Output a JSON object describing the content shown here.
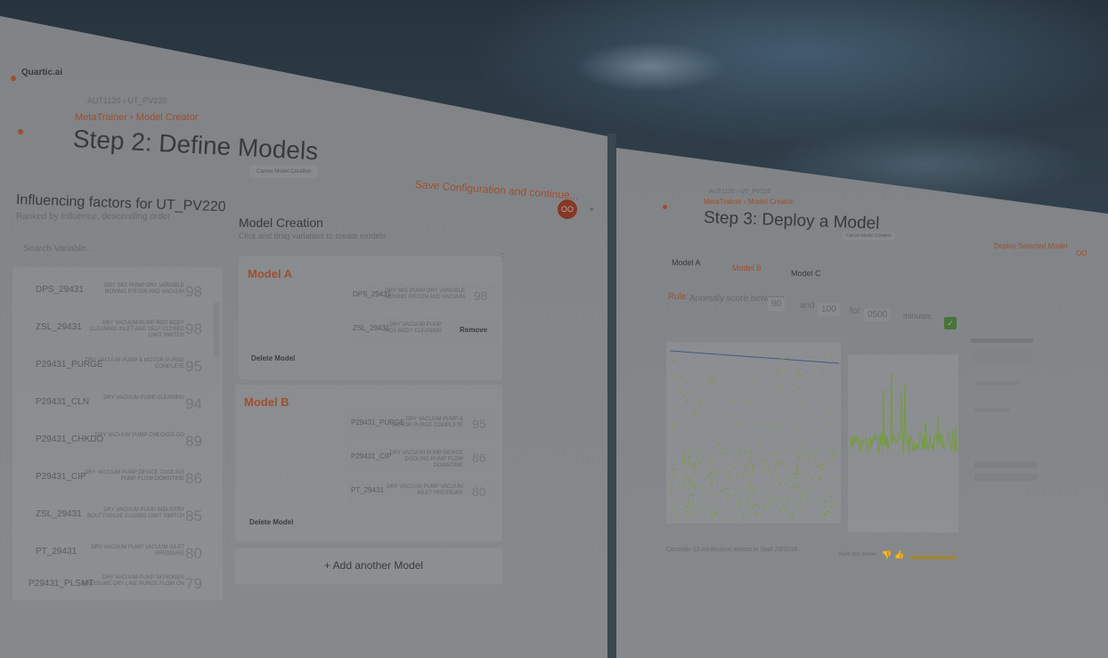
{
  "left": {
    "logo": "Quartic.ai",
    "breadcrumb": "AUT1120 › UT_PV220",
    "section": "MetaTrainer › Model Creator",
    "title": "Step 2: Define Models",
    "cancel_label": "Cancel Model Creation",
    "save_label": "Save Configuration and continue...",
    "avatar": "OO",
    "factors": {
      "title": "Influencing factors for UT_PV220",
      "subtitle": "Ranked by influence, descending order",
      "search_placeholder": "Search Variable...",
      "rows": [
        {
          "name": "DPS_29431",
          "desc": "DRY SKE PUMP DRY VARIABLE MOVING PISTON AND VACUUM",
          "score": "98"
        },
        {
          "name": "ZSL_29431",
          "desc": "DRY VACUUM PUMP ROS BODY CLEANING INLET AND SELF CLOSED LIMIT SWITCH",
          "score": "98"
        },
        {
          "name": "P29431_PURGE",
          "desc": "DRY VACUUM PUMP & MOTOR PURGE COMPLETE",
          "score": "95"
        },
        {
          "name": "P29431_CLN",
          "desc": "DRY VACUUM PUMP CLEANING",
          "score": "94"
        },
        {
          "name": "P29431_CHKDO",
          "desc": "DRY VACUUM PUMP CHECKED DO",
          "score": "89"
        },
        {
          "name": "P29431_CIP",
          "desc": "DRY VACUUM PUMP DEVICE COOLING PUMP FLOW DOWNTIME",
          "score": "86"
        },
        {
          "name": "ZSL_29431",
          "desc": "DRY VACUUM PUMP INDUSTRY BOUTTIVALVE CLOSED LIMIT SWITCH",
          "score": "85"
        },
        {
          "name": "PT_29431",
          "desc": "DRY VACUUM PUMP VACUUM INLET PRESSURE",
          "score": "80"
        },
        {
          "name": "P29431_PLSMT",
          "desc": "DRY VACUUM PUMP NITROGEN PRESSURE DRY LINE PURGE FLOW ON",
          "score": "79"
        }
      ]
    },
    "models": {
      "title": "Model Creation",
      "subtitle": "Click and drag variables to create models",
      "a": {
        "name": "Model A",
        "vars": [
          {
            "name": "DPS_29431",
            "desc": "DRY SKE PUMP DRY VARIABLE MOVING PISTON AND VACUUM",
            "score": "98"
          },
          {
            "name": "ZSL_29431",
            "desc": "DRY VACUUM PUMP ROS BODY CLEANING",
            "score": "Remove"
          }
        ],
        "delete_label": "Delete Model"
      },
      "b": {
        "name": "Model B",
        "vars": [
          {
            "name": "P29431_PURGE",
            "desc": "DRY VACUUM PUMP & MOTOR PURGE COMPLETE",
            "score": "95"
          },
          {
            "name": "P29431_CIP",
            "desc": "DRY VACUUM PUMP DEVICE COOLING PUMP FLOW DOWNTIME",
            "score": "86"
          },
          {
            "name": "PT_29431",
            "desc": "DRY VACUUM PUMP VACUUM INLET PRESSURE",
            "score": "80"
          }
        ],
        "delete_label": "Delete Model"
      },
      "add_label": "+ Add another Model"
    }
  },
  "right": {
    "breadcrumb": "AUT1120 › UT_PV220",
    "section": "MetaTrainer › Model Creator",
    "title": "Step 3: Deploy a Model",
    "cancel_label": "Cancel Model Creation",
    "deploy_label": "Deploy Selected Model",
    "avatar": "OO",
    "tabs": [
      "Model A",
      "Model B",
      "Model C"
    ],
    "active_tab": 1,
    "rule": {
      "prefix": "Rule:",
      "text": "Anomaly score between",
      "from": "90",
      "and_label": "and",
      "to": "100",
      "for_label": "for",
      "duration": "0500",
      "unit": "minutes",
      "apply_icon": "check-icon"
    },
    "footer_left": "Consider 13 continuous events in Sept 29/2018",
    "footer_mid": "Rate this model",
    "colors": {
      "accent": "#a8532e",
      "scatter": "#7fa24a",
      "line": "#4a5a8c"
    }
  }
}
